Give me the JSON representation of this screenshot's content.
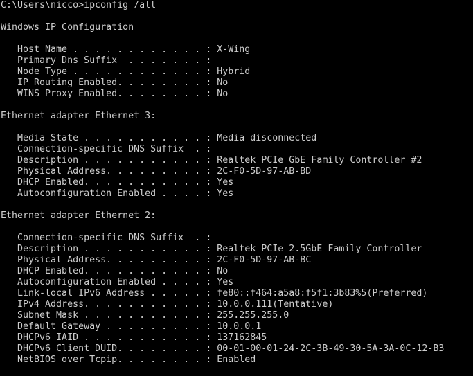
{
  "window": {
    "title": "Command Prompt",
    "background_color": "#000000",
    "text_color": "#cccccc"
  },
  "terminal": {
    "prompt_path": "C:\\Users\\nicco",
    "prompt_symbol": ">",
    "command": "ipconfig /all",
    "prompt_line": "C:\\Users\\nicco>ipconfig /all",
    "lines": [
      "C:\\Users\\nicco>ipconfig /all",
      "",
      "Windows IP Configuration",
      "",
      "   Host Name . . . . . . . . . . . . : X-Wing",
      "   Primary Dns Suffix  . . . . . . . :",
      "   Node Type . . . . . . . . . . . . : Hybrid",
      "   IP Routing Enabled. . . . . . . . : No",
      "   WINS Proxy Enabled. . . . . . . . : No",
      "",
      "Ethernet adapter Ethernet 3:",
      "",
      "   Media State . . . . . . . . . . . : Media disconnected",
      "   Connection-specific DNS Suffix  . :",
      "   Description . . . . . . . . . . . : Realtek PCIe GbE Family Controller #2",
      "   Physical Address. . . . . . . . . : 2C-F0-5D-97-AB-BD",
      "   DHCP Enabled. . . . . . . . . . . : Yes",
      "   Autoconfiguration Enabled . . . . : Yes",
      "",
      "Ethernet adapter Ethernet 2:",
      "",
      "   Connection-specific DNS Suffix  . :",
      "   Description . . . . . . . . . . . : Realtek PCIe 2.5GbE Family Controller",
      "   Physical Address. . . . . . . . . : 2C-F0-5D-97-AB-BC",
      "   DHCP Enabled. . . . . . . . . . . : No",
      "   Autoconfiguration Enabled . . . . : Yes",
      "   Link-local IPv6 Address . . . . . : fe80::f464:a5a8:f5f1:3b83%5(Preferred)",
      "   IPv4 Address. . . . . . . . . . . : 10.0.0.111(Tentative)",
      "   Subnet Mask . . . . . . . . . . . : 255.255.255.0",
      "   Default Gateway . . . . . . . . . : 10.0.0.1",
      "   DHCPv6 IAID . . . . . . . . . . . : 137162845",
      "   DHCPv6 Client DUID. . . . . . . . : 00-01-00-01-24-2C-3B-49-30-5A-3A-0C-12-B3",
      "   NetBIOS over Tcpip. . . . . . . . : Enabled"
    ],
    "sections": {
      "windows_ip_configuration": {
        "heading": "Windows IP Configuration",
        "entries": [
          {
            "label": "Host Name",
            "value": "X-Wing"
          },
          {
            "label": "Primary Dns Suffix",
            "value": ""
          },
          {
            "label": "Node Type",
            "value": "Hybrid"
          },
          {
            "label": "IP Routing Enabled",
            "value": "No"
          },
          {
            "label": "WINS Proxy Enabled",
            "value": "No"
          }
        ]
      },
      "ethernet_3": {
        "heading": "Ethernet adapter Ethernet 3:",
        "entries": [
          {
            "label": "Media State",
            "value": "Media disconnected"
          },
          {
            "label": "Connection-specific DNS Suffix",
            "value": ""
          },
          {
            "label": "Description",
            "value": "Realtek PCIe GbE Family Controller #2"
          },
          {
            "label": "Physical Address",
            "value": "2C-F0-5D-97-AB-BD"
          },
          {
            "label": "DHCP Enabled",
            "value": "Yes"
          },
          {
            "label": "Autoconfiguration Enabled",
            "value": "Yes"
          }
        ]
      },
      "ethernet_2": {
        "heading": "Ethernet adapter Ethernet 2:",
        "entries": [
          {
            "label": "Connection-specific DNS Suffix",
            "value": ""
          },
          {
            "label": "Description",
            "value": "Realtek PCIe 2.5GbE Family Controller"
          },
          {
            "label": "Physical Address",
            "value": "2C-F0-5D-97-AB-BC"
          },
          {
            "label": "DHCP Enabled",
            "value": "No"
          },
          {
            "label": "Autoconfiguration Enabled",
            "value": "Yes"
          },
          {
            "label": "Link-local IPv6 Address",
            "value": "fe80::f464:a5a8:f5f1:3b83%5(Preferred)"
          },
          {
            "label": "IPv4 Address",
            "value": "10.0.0.111(Tentative)"
          },
          {
            "label": "Subnet Mask",
            "value": "255.255.255.0"
          },
          {
            "label": "Default Gateway",
            "value": "10.0.0.1"
          },
          {
            "label": "DHCPv6 IAID",
            "value": "137162845"
          },
          {
            "label": "DHCPv6 Client DUID",
            "value": "00-01-00-01-24-2C-3B-49-30-5A-3A-0C-12-B3"
          },
          {
            "label": "NetBIOS over Tcpip",
            "value": "Enabled"
          }
        ]
      }
    }
  }
}
